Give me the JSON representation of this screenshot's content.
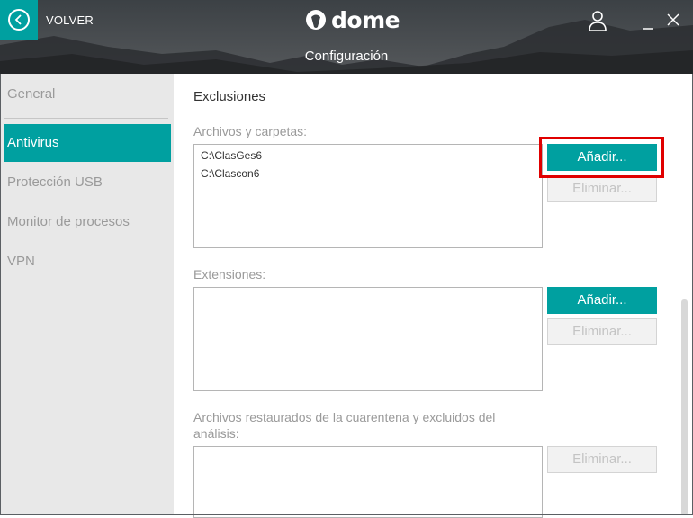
{
  "header": {
    "back_label": "VOLVER",
    "logo_text": "dome",
    "logo_small_text": "Panda",
    "title": "Configuración",
    "icons": {
      "back": "chevron-left-icon",
      "user": "user-icon",
      "minimize": "minimize-icon",
      "close": "close-icon"
    }
  },
  "sidebar": {
    "items": [
      {
        "label": "General",
        "active": false
      },
      {
        "label": "Antivirus",
        "active": true
      },
      {
        "label": "Protección USB",
        "active": false
      },
      {
        "label": "Monitor de procesos",
        "active": false
      },
      {
        "label": "VPN",
        "active": false
      }
    ]
  },
  "main": {
    "section_title": "Exclusiones",
    "files_folders": {
      "label": "Archivos y carpetas:",
      "items": [
        "C:\\ClasGes6",
        "C:\\Clascon6"
      ],
      "add_label": "Añadir...",
      "remove_label": "Eliminar..."
    },
    "extensions": {
      "label": "Extensiones:",
      "items": [],
      "add_label": "Añadir...",
      "remove_label": "Eliminar..."
    },
    "restored": {
      "label": "Archivos restaurados de la cuarentena y excluidos del análisis:",
      "items": [],
      "remove_label": "Eliminar..."
    }
  },
  "colors": {
    "accent": "#00a0a0",
    "highlight": "#e00000",
    "sidebar_bg": "#e8e8e8",
    "disabled_text": "#c4c4c4"
  }
}
